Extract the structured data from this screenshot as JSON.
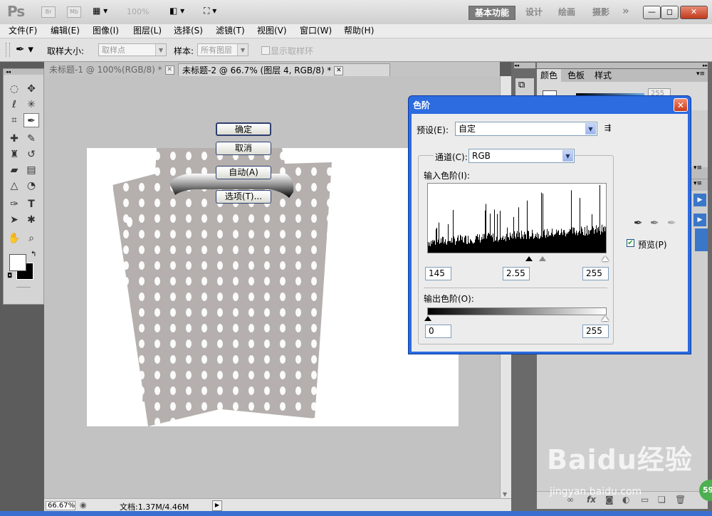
{
  "app": {
    "logo": "Ps",
    "mini_bridge": "Br",
    "mini_mb": "Mb",
    "zoom": "100%",
    "workspaces": [
      "基本功能",
      "设计",
      "绘画",
      "摄影"
    ],
    "more": "»",
    "win_min": "—",
    "win_max": "◻",
    "win_close": "✕"
  },
  "menu": [
    "文件(F)",
    "编辑(E)",
    "图像(I)",
    "图层(L)",
    "选择(S)",
    "滤镜(T)",
    "视图(V)",
    "窗口(W)",
    "帮助(H)"
  ],
  "options": {
    "sample_size_label": "取样大小:",
    "sample_size_value": "取样点",
    "sample_label": "样本:",
    "sample_value": "所有图层",
    "show_ring": "显示取样环"
  },
  "tabs": [
    {
      "label": "未标题-1 @ 100%(RGB/8) *"
    },
    {
      "label": "未标题-2 @ 66.7% (图层 4, RGB/8) *"
    }
  ],
  "status": {
    "zoom": "66.67%",
    "doc": "文档:1.37M/4.46M"
  },
  "panels": {
    "tabs": [
      "颜色",
      "色板",
      "样式"
    ],
    "value": "255"
  },
  "dialog": {
    "title": "色阶",
    "preset_label": "预设(E):",
    "preset_value": "自定",
    "channel_label": "通道(C):",
    "channel_value": "RGB",
    "input_label": "输入色阶(I):",
    "input_black": "145",
    "input_gamma": "2.55",
    "input_white": "255",
    "output_label": "输出色阶(O):",
    "output_black": "0",
    "output_white": "255",
    "buttons": {
      "ok": "确定",
      "cancel": "取消",
      "auto": "自动(A)",
      "options": "选项(T)..."
    },
    "preview_label": "预览(P)",
    "preview_checked": true
  },
  "watermark": {
    "logo": "Baidu经验",
    "url": "jingyan.baidu.com",
    "badge": "59"
  }
}
